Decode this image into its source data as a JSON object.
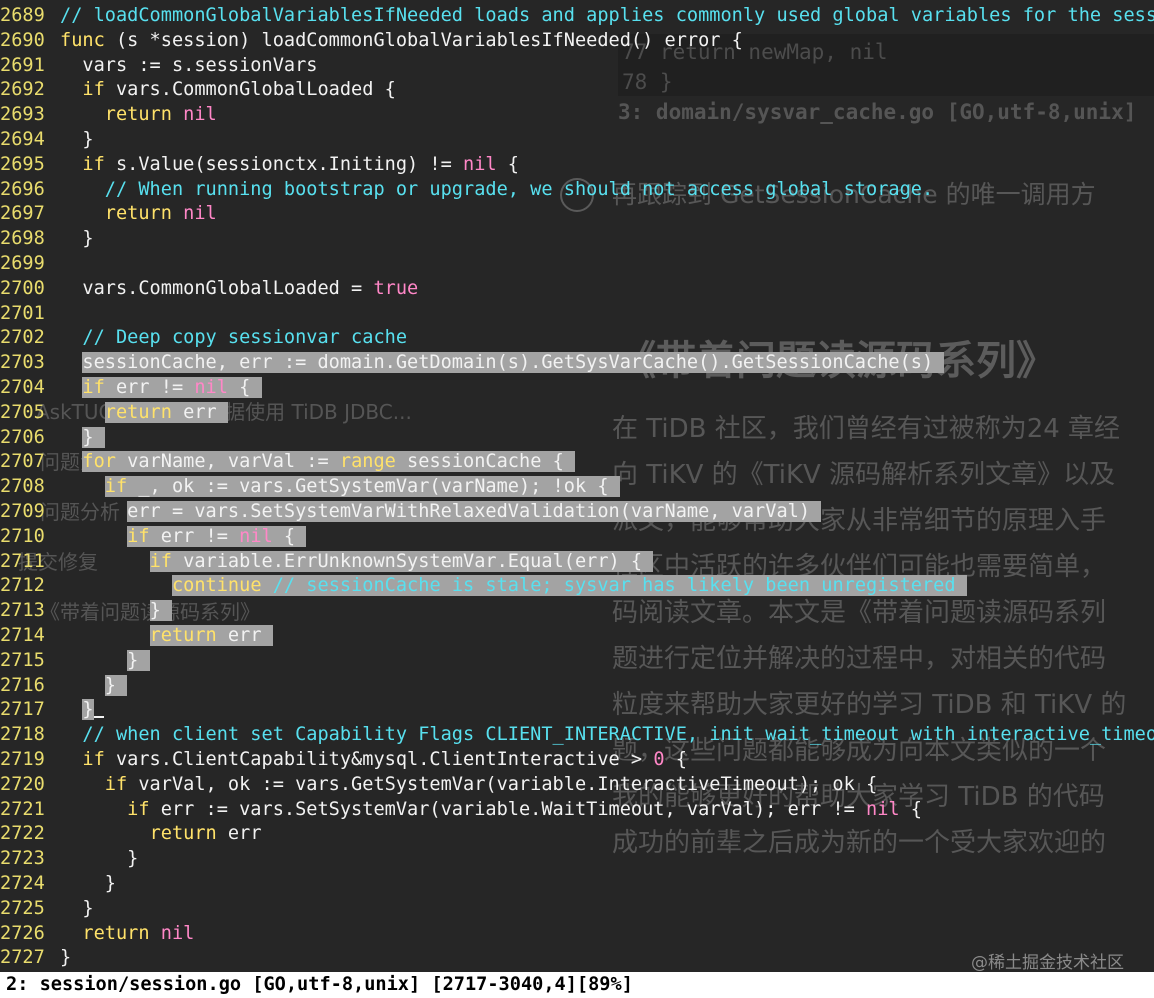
{
  "background": {
    "code_lines": [
      "77    return newMap, nil",
      "78  }"
    ],
    "status": "3: domain/sysvar_cache.go [GO,utf-8,unix]",
    "note": "再跟踪到 GetSessionCache 的唯一调用方",
    "title": "《带着问题读源码系列》",
    "paragraph": [
      "在 TiDB 社区，我们曾经有过被称为24 章经",
      "向 TiKV 的《TiKV 源码解析系列文章》以及",
      "派文，能够帮助大家从非常细节的原理入手",
      "社区中活跃的许多伙伴们可能也需要简单，",
      "码阅读文章。本文是《带着问题读源码系列",
      "题进行定位并解决的过程中，对相关的代码",
      "粒度来帮助大家更好的学习 TiDB 和 TiKV 的",
      "题，这些问题都能够成为向本文类似的一个",
      "我的能够更好的帮助大家学习 TiDB 的代码",
      "成功的前辈之后成为新的一个受大家欢迎的"
    ],
    "left_links": [
      "AskTUG：Hive 元数据使用 TiDB JDBC...",
      "问题流程",
      "问题分析",
      "提交修复",
      "《带着问题读源码系列》"
    ]
  },
  "editor": {
    "lines": [
      {
        "n": "2689",
        "text": "// loadCommonGlobalVariablesIfNeeded loads and applies commonly used global variables for the session."
      },
      {
        "n": "2690",
        "text": "func (s *session) loadCommonGlobalVariablesIfNeeded() error {"
      },
      {
        "n": "2691",
        "text": "  vars := s.sessionVars"
      },
      {
        "n": "2692",
        "text": "  if vars.CommonGlobalLoaded {"
      },
      {
        "n": "2693",
        "text": "    return nil"
      },
      {
        "n": "2694",
        "text": "  }"
      },
      {
        "n": "2695",
        "text": "  if s.Value(sessionctx.Initing) != nil {"
      },
      {
        "n": "2696",
        "text": "    // When running bootstrap or upgrade, we should not access global storage."
      },
      {
        "n": "2697",
        "text": "    return nil"
      },
      {
        "n": "2698",
        "text": "  }"
      },
      {
        "n": "2699",
        "text": ""
      },
      {
        "n": "2700",
        "text": "  vars.CommonGlobalLoaded = true"
      },
      {
        "n": "2701",
        "text": ""
      },
      {
        "n": "2702",
        "text": "  // Deep copy sessionvar cache"
      },
      {
        "n": "2703",
        "text": "  sessionCache, err := domain.GetDomain(s).GetSysVarCache().GetSessionCache(s)"
      },
      {
        "n": "2704",
        "text": "  if err != nil {"
      },
      {
        "n": "2705",
        "text": "    return err"
      },
      {
        "n": "2706",
        "text": "  }"
      },
      {
        "n": "2707",
        "text": "  for varName, varVal := range sessionCache {"
      },
      {
        "n": "2708",
        "text": "    if _, ok := vars.GetSystemVar(varName); !ok {"
      },
      {
        "n": "2709",
        "text": "      err = vars.SetSystemVarWithRelaxedValidation(varName, varVal)"
      },
      {
        "n": "2710",
        "text": "      if err != nil {"
      },
      {
        "n": "2711",
        "text": "        if variable.ErrUnknownSystemVar.Equal(err) {"
      },
      {
        "n": "2712",
        "text": "          continue // sessionCache is stale; sysvar has likely been unregistered"
      },
      {
        "n": "2713",
        "text": "        }"
      },
      {
        "n": "2714",
        "text": "        return err"
      },
      {
        "n": "2715",
        "text": "      }"
      },
      {
        "n": "2716",
        "text": "    }"
      },
      {
        "n": "2717",
        "text": "  }"
      },
      {
        "n": "2718",
        "text": "  // when client set Capability Flags CLIENT_INTERACTIVE, init wait_timeout with interactive_timeout"
      },
      {
        "n": "2719",
        "text": "  if vars.ClientCapability&mysql.ClientInteractive > 0 {"
      },
      {
        "n": "2720",
        "text": "    if varVal, ok := vars.GetSystemVar(variable.InteractiveTimeout); ok {"
      },
      {
        "n": "2721",
        "text": "      if err := vars.SetSystemVar(variable.WaitTimeout, varVal); err != nil {"
      },
      {
        "n": "2722",
        "text": "        return err"
      },
      {
        "n": "2723",
        "text": "      }"
      },
      {
        "n": "2724",
        "text": "    }"
      },
      {
        "n": "2725",
        "text": "  }"
      },
      {
        "n": "2726",
        "text": "  return nil"
      },
      {
        "n": "2727",
        "text": "}"
      }
    ]
  },
  "statusline": "2: session/session.go [GO,utf-8,unix] [2717-3040,4][89%]",
  "watermark": "@稀土掘金技术社区",
  "colors": {
    "line_number": "#e9dc6d",
    "keyword": "#ffe26a",
    "comment": "#58e0ef",
    "literal": "#ff87c7",
    "selection": "#a3a3a3"
  }
}
